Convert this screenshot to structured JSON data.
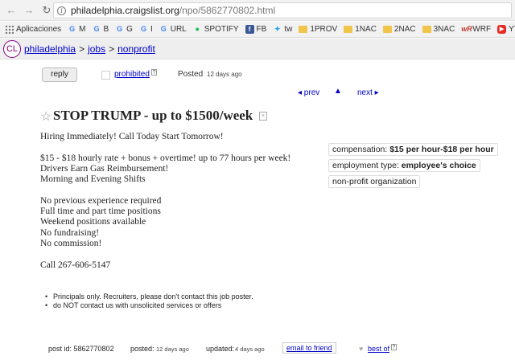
{
  "browser": {
    "url_host": "philadelphia.craigslist.org",
    "url_path": "/npo/5862770802.html",
    "bookmarks": [
      {
        "label": "Aplicaciones",
        "icon": "apps-icon"
      },
      {
        "label": "M",
        "icon": "google-icon"
      },
      {
        "label": "B",
        "icon": "google-icon"
      },
      {
        "label": "G",
        "icon": "google-icon"
      },
      {
        "label": "I",
        "icon": "google-icon"
      },
      {
        "label": "URL",
        "icon": "google-icon"
      },
      {
        "label": "SPOTIFY",
        "icon": "spotify-icon"
      },
      {
        "label": "FB",
        "icon": "facebook-icon"
      },
      {
        "label": "tw",
        "icon": "twitter-icon"
      },
      {
        "label": "1PROV",
        "icon": "folder-icon"
      },
      {
        "label": "1NAC",
        "icon": "folder-icon"
      },
      {
        "label": "2NAC",
        "icon": "folder-icon"
      },
      {
        "label": "3NAC",
        "icon": "folder-icon"
      },
      {
        "label": "WRF",
        "icon": "wordreference-icon"
      },
      {
        "label": "YT",
        "icon": "youtube-icon"
      }
    ]
  },
  "header": {
    "logo": "CL",
    "breadcrumb": [
      "philadelphia",
      "jobs",
      "nonprofit"
    ]
  },
  "actions": {
    "reply": "reply",
    "prohibited": "prohibited",
    "posted_label": "Posted",
    "posted_ago": "12 days ago",
    "prev": "◂ prev",
    "up": "▲",
    "next": "next ▸"
  },
  "post": {
    "title": "STOP TRUMP - up to $1500/week",
    "body_lines": [
      "Hiring Immediately! Call Today Start Tomorrow!",
      "",
      "$15 - $18 hourly rate + bonus + overtime! up to 77 hours per week!",
      "Drivers Earn Gas Reimbursement!",
      "Morning and Evening Shifts",
      "",
      "No previous experience required",
      "Full time and part time positions",
      "Weekend positions available",
      "No fundraising!",
      "No commission!",
      "",
      "Call 267-606-5147"
    ],
    "attributes": [
      {
        "label": "compensation: ",
        "value": "$15 per hour-$18 per hour"
      },
      {
        "label": "employment type: ",
        "value": "employee's choice"
      },
      {
        "label": "non-profit organization",
        "value": ""
      }
    ],
    "notices": [
      "Principals only. Recruiters, please don't contact this job poster.",
      "do NOT contact us with unsolicited services or offers"
    ]
  },
  "footer": {
    "post_id_label": "post id: 5862770802",
    "posted_label": "posted:",
    "posted_ago": "12 days ago",
    "updated_label": "updated:",
    "updated_ago": "4 days ago",
    "email_friend": "email to friend",
    "best_of": "best of"
  }
}
